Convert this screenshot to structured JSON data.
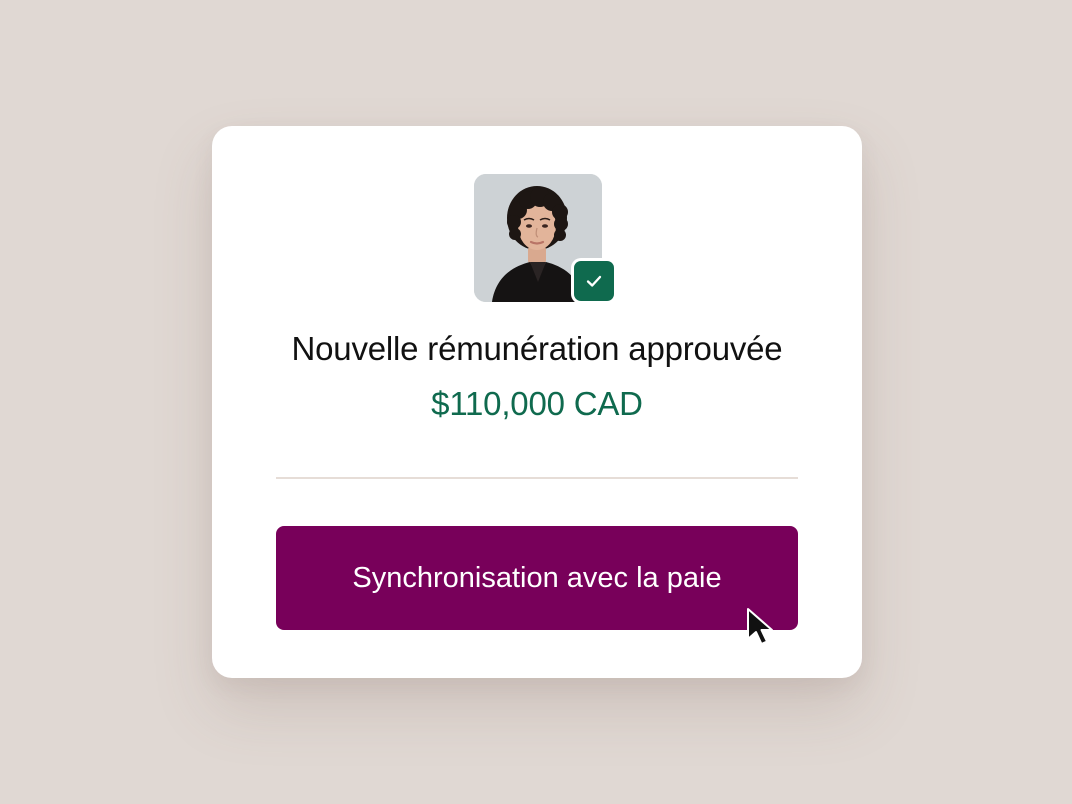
{
  "card": {
    "title": "Nouvelle rémunération approuvée",
    "amount": "$110,000 CAD",
    "button_label": "Synchronisation avec la paie"
  },
  "avatar": {
    "status": "approved",
    "badge_icon": "check-icon"
  },
  "colors": {
    "background": "#e0d8d3",
    "card": "#ffffff",
    "accent_green": "#0f6a4e",
    "button": "#78005a"
  },
  "icons": [
    "check-icon",
    "cursor-icon"
  ]
}
